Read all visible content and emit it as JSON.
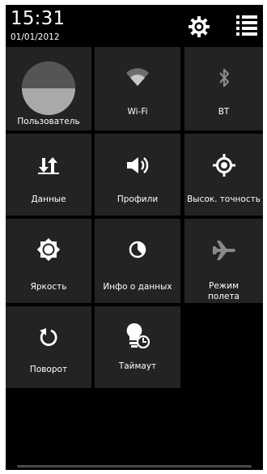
{
  "status": {
    "time": "15:31",
    "date": "01/01/2012"
  },
  "header_icons": {
    "settings": "gear-icon",
    "menu": "list-menu-icon"
  },
  "tiles": [
    {
      "label": "Пользователь",
      "icon": "user-avatar"
    },
    {
      "label": "Wi-Fi",
      "icon": "wifi-icon"
    },
    {
      "label": "BT",
      "icon": "bluetooth-icon"
    },
    {
      "label": "Данные",
      "icon": "data-transfer-icon"
    },
    {
      "label": "Профили",
      "icon": "speaker-icon"
    },
    {
      "label": "Высок. точность",
      "icon": "location-target-icon"
    },
    {
      "label": "Яркость",
      "icon": "brightness-icon"
    },
    {
      "label": "Инфо о данных",
      "icon": "data-usage-icon"
    },
    {
      "label": "Режим полета",
      "icon": "airplane-icon"
    },
    {
      "label": "Поворот",
      "icon": "rotate-icon"
    },
    {
      "label": "Таймаут",
      "icon": "bulb-timer-icon"
    }
  ],
  "colors": {
    "background": "#000000",
    "tile": "#232323",
    "icon": "#ffffff",
    "icon_dim": "#8a8a8a"
  }
}
